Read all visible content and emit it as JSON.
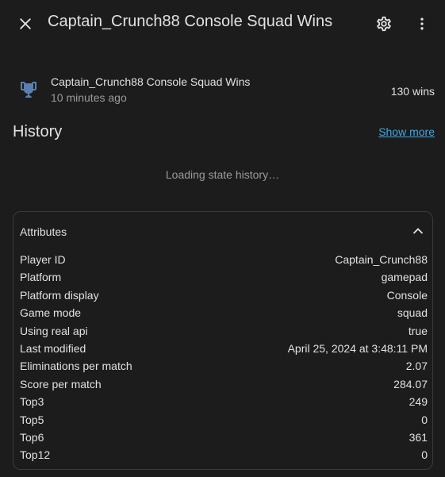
{
  "header": {
    "title": "Captain_Crunch88 Console Squad Wins",
    "close_icon": "close-icon",
    "settings_icon": "gear-icon",
    "more_icon": "more-vertical-icon"
  },
  "entity": {
    "icon": "trophy-icon",
    "name": "Captain_Crunch88 Console Squad Wins",
    "last_changed": "10 minutes ago",
    "state": "130 wins"
  },
  "history": {
    "title": "History",
    "show_more": "Show more",
    "loading": "Loading state history…"
  },
  "attributes": {
    "title": "Attributes",
    "items": [
      {
        "key": "Player ID",
        "value": "Captain_Crunch88"
      },
      {
        "key": "Platform",
        "value": "gamepad"
      },
      {
        "key": "Platform display",
        "value": "Console"
      },
      {
        "key": "Game mode",
        "value": "squad"
      },
      {
        "key": "Using real api",
        "value": "true"
      },
      {
        "key": "Last modified",
        "value": "April 25, 2024 at 3:48:11 PM"
      },
      {
        "key": "Eliminations per match",
        "value": "2.07"
      },
      {
        "key": "Score per match",
        "value": "284.07"
      },
      {
        "key": "Top3",
        "value": "249"
      },
      {
        "key": "Top5",
        "value": "0"
      },
      {
        "key": "Top6",
        "value": "361"
      },
      {
        "key": "Top12",
        "value": "0"
      }
    ]
  },
  "colors": {
    "background": "#1c1c1c",
    "text": "#e1e1e1",
    "secondary_text": "#9b9b9b",
    "link": "#41a5dc",
    "icon_accent": "#5a7fb0"
  }
}
